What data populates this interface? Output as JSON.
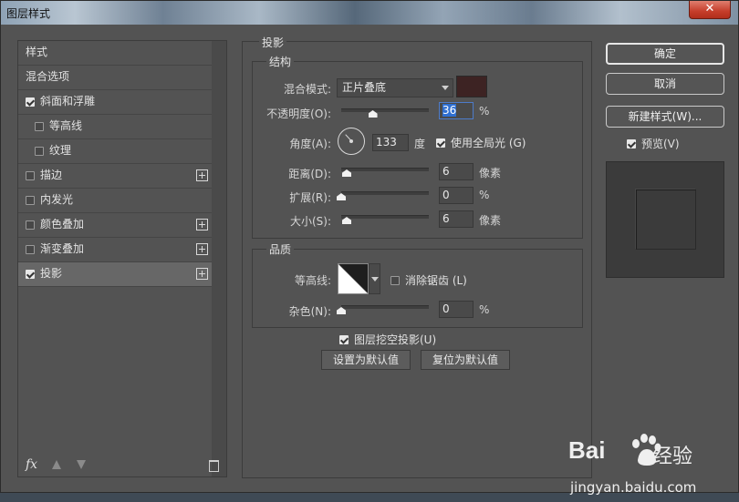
{
  "window": {
    "title": "图层样式",
    "close_label": "✕"
  },
  "styles": {
    "items": [
      {
        "label": "样式",
        "has_checkbox": false,
        "checked": false,
        "has_plus": false,
        "indent": 0,
        "selected": false
      },
      {
        "label": "混合选项",
        "has_checkbox": false,
        "checked": false,
        "has_plus": false,
        "indent": 0,
        "selected": false
      },
      {
        "label": "斜面和浮雕",
        "has_checkbox": true,
        "checked": true,
        "has_plus": false,
        "indent": 0,
        "selected": false
      },
      {
        "label": "等高线",
        "has_checkbox": true,
        "checked": false,
        "has_plus": false,
        "indent": 1,
        "selected": false
      },
      {
        "label": "纹理",
        "has_checkbox": true,
        "checked": false,
        "has_plus": false,
        "indent": 1,
        "selected": false
      },
      {
        "label": "描边",
        "has_checkbox": true,
        "checked": false,
        "has_plus": true,
        "indent": 0,
        "selected": false
      },
      {
        "label": "内发光",
        "has_checkbox": true,
        "checked": false,
        "has_plus": false,
        "indent": 0,
        "selected": false
      },
      {
        "label": "颜色叠加",
        "has_checkbox": true,
        "checked": false,
        "has_plus": true,
        "indent": 0,
        "selected": false
      },
      {
        "label": "渐变叠加",
        "has_checkbox": true,
        "checked": false,
        "has_plus": true,
        "indent": 0,
        "selected": false
      },
      {
        "label": "投影",
        "has_checkbox": true,
        "checked": true,
        "has_plus": true,
        "indent": 0,
        "selected": true
      }
    ],
    "bottom_icons": [
      "fx-icon",
      "arrow-up-icon",
      "arrow-down-icon",
      "trash-icon"
    ],
    "fx_label": "fx"
  },
  "shadow": {
    "section_title": "投影",
    "structure": {
      "title": "结构",
      "blend_mode_label": "混合模式:",
      "blend_mode_value": "正片叠底",
      "shadow_color": "#3d2323",
      "opacity_label": "不透明度(O):",
      "opacity_value": "36",
      "opacity_fraction": 0.36,
      "percent": "%",
      "angle_label": "角度(A):",
      "angle_value": "133",
      "angle_unit": "度",
      "global_light_label": "使用全局光 (G)",
      "global_light_checked": true,
      "distance_label": "距离(D):",
      "distance_value": "6",
      "distance_unit": "像素",
      "spread_label": "扩展(R):",
      "spread_value": "0",
      "spread_unit": "%",
      "size_label": "大小(S):",
      "size_value": "6",
      "size_unit": "像素"
    },
    "quality": {
      "title": "品质",
      "contour_label": "等高线:",
      "antialias_label": "消除锯齿 (L)",
      "antialias_checked": false,
      "noise_label": "杂色(N):",
      "noise_value": "0",
      "noise_unit": "%"
    },
    "knockout_label": "图层挖空投影(U)",
    "knockout_checked": true,
    "make_default_label": "设置为默认值",
    "reset_default_label": "复位为默认值"
  },
  "right": {
    "ok_label": "确定",
    "cancel_label": "取消",
    "new_style_label": "新建样式(W)...",
    "preview_label": "预览(V)",
    "preview_checked": true
  },
  "watermark": {
    "logo_left": "Bai",
    "logo_right": "经验",
    "url": "jingyan.baidu.com"
  }
}
